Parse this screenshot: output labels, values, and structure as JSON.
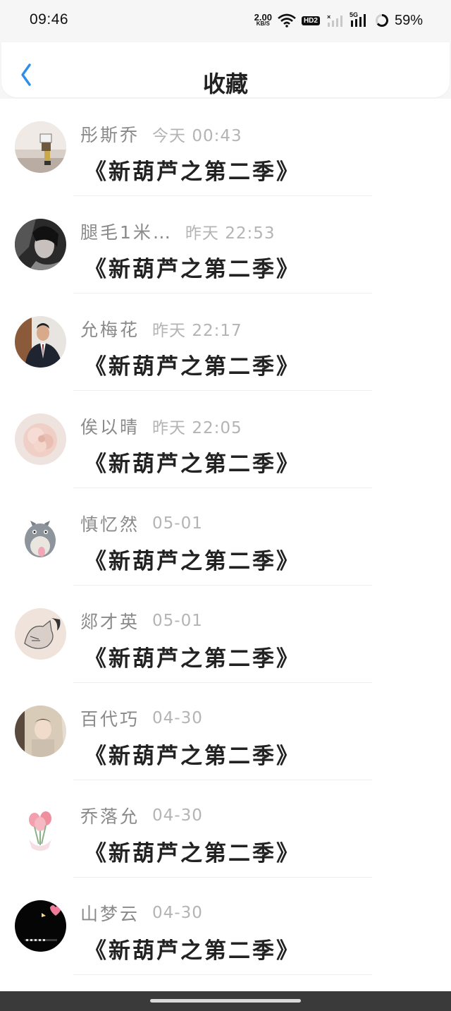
{
  "status": {
    "time": "09:46",
    "net_speed": "2.00",
    "net_unit": "KB/S",
    "hd": "HD2",
    "signal_5g": "5G",
    "battery": "59%"
  },
  "header": {
    "title": "收藏"
  },
  "items": [
    {
      "name": "彤斯乔",
      "time": "今天 00:43",
      "content": "《新葫芦之第二季》",
      "avatar": "figurine-avatar-icon"
    },
    {
      "name": "腿毛1米…",
      "time": "昨天 22:53",
      "content": "《新葫芦之第二季》",
      "avatar": "dark-portrait-avatar-icon"
    },
    {
      "name": "允梅花",
      "time": "昨天 22:17",
      "content": "《新葫芦之第二季》",
      "avatar": "suit-man-avatar-icon"
    },
    {
      "name": "俟以晴",
      "time": "昨天 22:05",
      "content": "《新葫芦之第二季》",
      "avatar": "pink-flower-avatar-icon"
    },
    {
      "name": "慎忆然",
      "time": "05-01",
      "content": "《新葫芦之第二季》",
      "avatar": "totoro-avatar-icon"
    },
    {
      "name": "郯才英",
      "time": "05-01",
      "content": "《新葫芦之第二季》",
      "avatar": "cat-sketch-avatar-icon"
    },
    {
      "name": "百代巧",
      "time": "04-30",
      "content": "《新葫芦之第二季》",
      "avatar": "cozy-person-avatar-icon"
    },
    {
      "name": "乔落允",
      "time": "04-30",
      "content": "《新葫芦之第二季》",
      "avatar": "tulip-avatar-icon"
    },
    {
      "name": "山梦云",
      "time": "04-30",
      "content": "《新葫芦之第二季》",
      "avatar": "black-heart-avatar-icon"
    }
  ]
}
